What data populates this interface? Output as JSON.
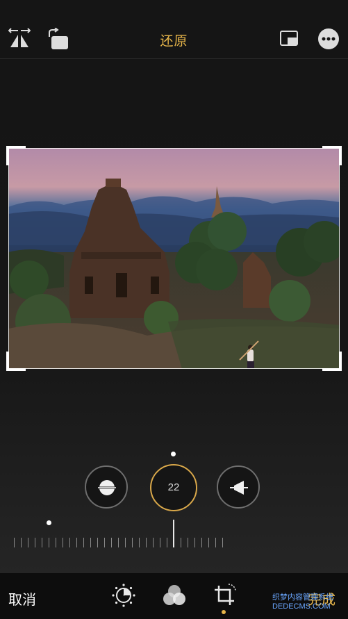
{
  "header": {
    "title": "还原",
    "icons": [
      "flip-icon",
      "rotate-icon",
      "aspect-ratio-icon",
      "more-icon"
    ]
  },
  "editor": {
    "dials": [
      {
        "name": "straighten",
        "icon": "horizon-icon"
      },
      {
        "name": "rotation",
        "value": "22"
      },
      {
        "name": "vertical",
        "icon": "perspective-icon"
      }
    ],
    "ruler_position": 0.5
  },
  "footer": {
    "cancel_label": "取消",
    "done_label": "完成",
    "tools": [
      "adjust-icon",
      "filters-icon",
      "crop-icon"
    ],
    "active_tool": "crop"
  },
  "watermark": {
    "line1": "织梦内容管理系统",
    "line2": "DEDECMS.COM"
  },
  "colors": {
    "accent": "#e6b54a",
    "background": "#141414"
  }
}
